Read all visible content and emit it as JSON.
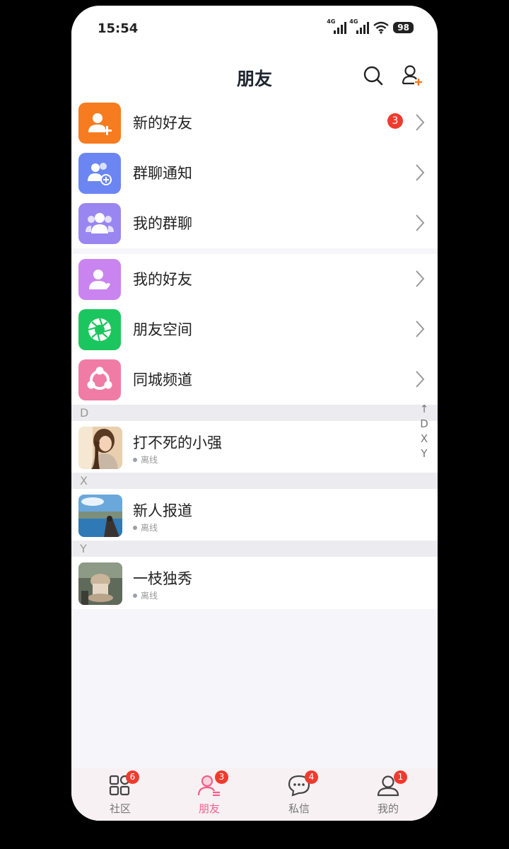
{
  "status_bar": {
    "time": "15:54",
    "network1": "4G",
    "network2": "4G",
    "battery": "98"
  },
  "header": {
    "title": "朋友",
    "search_icon": "search-icon",
    "add_friend_icon": "add-friend-icon"
  },
  "menu_group_1": [
    {
      "label": "新的好友",
      "icon": "add-person-icon",
      "color": "#f77b1f",
      "badge": "3"
    },
    {
      "label": "群聊通知",
      "icon": "group-notify-icon",
      "color": "#6b86f3"
    },
    {
      "label": "我的群聊",
      "icon": "group-icon",
      "color": "#9a86f0"
    }
  ],
  "menu_group_2": [
    {
      "label": "我的好友",
      "icon": "friend-icon",
      "color": "#c984ef"
    },
    {
      "label": "朋友空间",
      "icon": "aperture-icon",
      "color": "#1cc65e"
    },
    {
      "label": "同城频道",
      "icon": "city-channel-icon",
      "color": "#f07ca6"
    }
  ],
  "index_bar": [
    "↑",
    "D",
    "X",
    "Y"
  ],
  "sections": [
    {
      "letter": "D",
      "contacts": [
        {
          "name": "打不死的小强",
          "status": "离线"
        }
      ]
    },
    {
      "letter": "X",
      "contacts": [
        {
          "name": "新人报道",
          "status": "离线"
        }
      ]
    },
    {
      "letter": "Y",
      "contacts": [
        {
          "name": "一枝独秀",
          "status": "离线"
        }
      ]
    }
  ],
  "tabs": [
    {
      "label": "社区",
      "badge": "6",
      "icon": "community-icon"
    },
    {
      "label": "朋友",
      "badge": "3",
      "icon": "friends-icon",
      "active": true
    },
    {
      "label": "私信",
      "badge": "4",
      "icon": "message-icon"
    },
    {
      "label": "我的",
      "badge": "1",
      "icon": "profile-icon"
    }
  ],
  "colors": {
    "accent": "#f25f8a",
    "badge": "#ef3b2e"
  }
}
